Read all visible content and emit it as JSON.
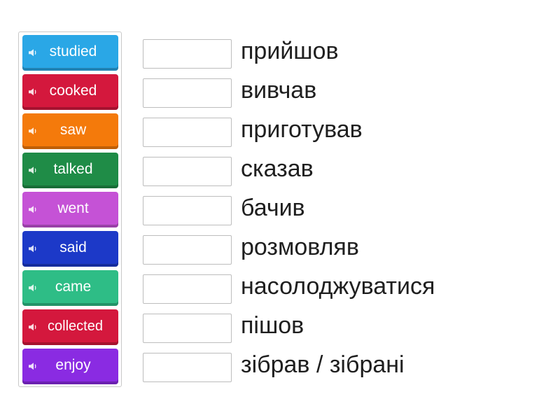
{
  "tiles": [
    {
      "label": "studied",
      "color": "#2aa7e6"
    },
    {
      "label": "cooked",
      "color": "#d4183d"
    },
    {
      "label": "saw",
      "color": "#f47a0b"
    },
    {
      "label": "talked",
      "color": "#1f8c47"
    },
    {
      "label": "went",
      "color": "#c552d6"
    },
    {
      "label": "said",
      "color": "#1c39c8"
    },
    {
      "label": "came",
      "color": "#2ebd86"
    },
    {
      "label": "collected",
      "color": "#d4183d"
    },
    {
      "label": "enjoy",
      "color": "#8a2be2"
    }
  ],
  "targets": [
    "прийшов",
    "вивчав",
    "приготував",
    "сказав",
    "бачив",
    "розмовляв",
    "насолоджуватися",
    "пішов",
    "зібрав / зібрані"
  ],
  "icons": {
    "tile_audio": "speaker-icon"
  }
}
